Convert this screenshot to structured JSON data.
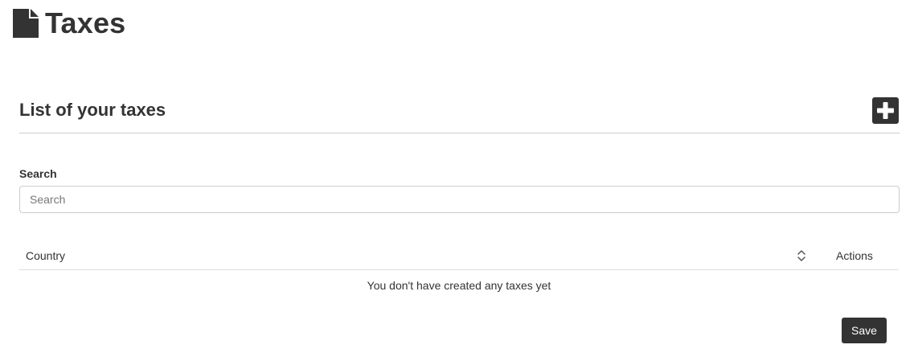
{
  "header": {
    "icon": "file-icon",
    "title": "Taxes"
  },
  "section": {
    "title": "List of your taxes",
    "add_icon": "plus-icon"
  },
  "search": {
    "label": "Search",
    "placeholder": "Search",
    "value": ""
  },
  "table": {
    "columns": [
      "Country",
      "Actions"
    ],
    "sort_icon": "sort-icon",
    "empty_message": "You don't have created any taxes yet"
  },
  "footer": {
    "save_label": "Save"
  },
  "colors": {
    "text": "#333333",
    "button_bg": "#333333",
    "button_text": "#ffffff",
    "border": "#cccccc"
  }
}
